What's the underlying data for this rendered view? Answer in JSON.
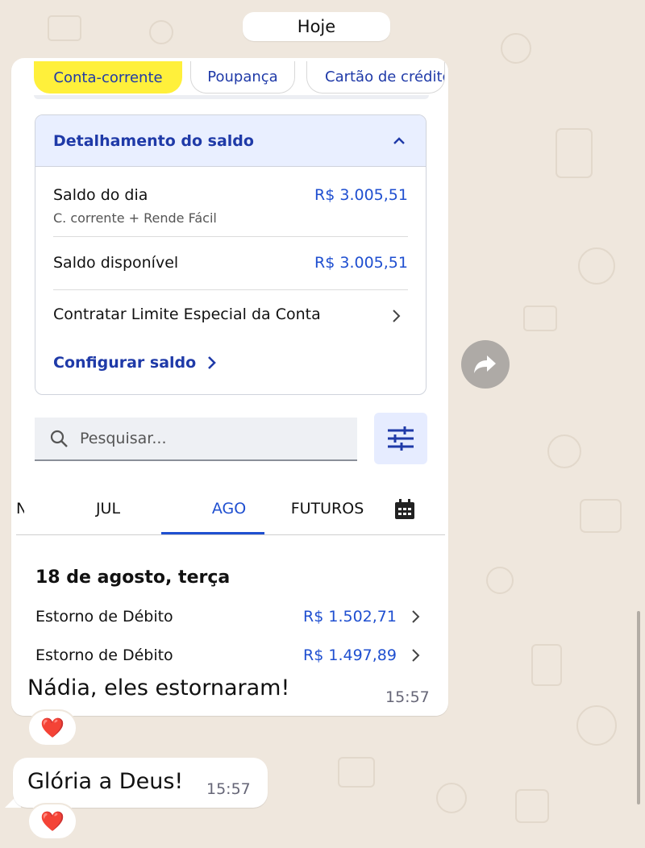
{
  "chat": {
    "date_label": "Hoje",
    "messages": [
      {
        "caption": "Nádia, eles estornaram!",
        "time": "15:57",
        "reaction": "❤️"
      },
      {
        "text": "Glória a Deus!",
        "time": "15:57",
        "reaction": "❤️"
      }
    ]
  },
  "screenshot": {
    "account_tabs": [
      "Conta-corrente",
      "Poupança",
      "Cartão de crédito"
    ],
    "active_account_tab": "Conta-corrente",
    "balance_card": {
      "title": "Detalhamento do saldo",
      "rows": [
        {
          "label": "Saldo do dia",
          "sub": "C. corrente + Rende Fácil",
          "value": "R$ 3.005,51"
        },
        {
          "label": "Saldo disponível",
          "value": "R$ 3.005,51"
        },
        {
          "label": "Contratar Limite Especial da Conta"
        }
      ],
      "link": "Configurar saldo"
    },
    "search_placeholder": "Pesquisar...",
    "month_tabs": [
      "JUL",
      "AGO",
      "FUTUROS"
    ],
    "active_month": "AGO",
    "day_header": "18 de agosto, terça",
    "transactions": [
      {
        "label": "Estorno de Débito",
        "value": "R$ 1.502,71"
      },
      {
        "label": "Estorno de Débito",
        "value": "R$ 1.497,89"
      }
    ]
  },
  "colors": {
    "chat_background": "#efe7dd",
    "bank_blue": "#1f3aa8",
    "amount_blue": "#1f4fd0",
    "active_tab_yellow": "#fff03b"
  }
}
